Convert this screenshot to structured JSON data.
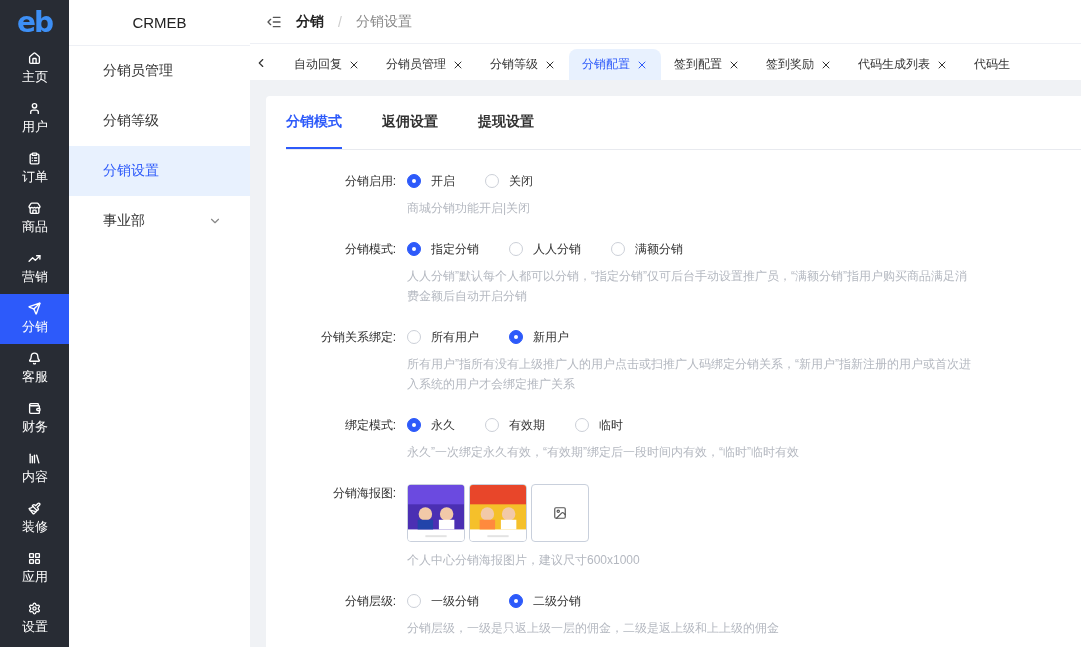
{
  "rail": {
    "logo": "eb",
    "items": [
      {
        "label": "主页",
        "selected": false
      },
      {
        "label": "用户",
        "selected": false
      },
      {
        "label": "订单",
        "selected": false
      },
      {
        "label": "商品",
        "selected": false
      },
      {
        "label": "营销",
        "selected": false
      },
      {
        "label": "分销",
        "selected": true
      },
      {
        "label": "客服",
        "selected": false
      },
      {
        "label": "财务",
        "selected": false
      },
      {
        "label": "内容",
        "selected": false
      },
      {
        "label": "装修",
        "selected": false
      },
      {
        "label": "应用",
        "selected": false
      },
      {
        "label": "设置",
        "selected": false
      }
    ]
  },
  "submenu": {
    "title": "CRMEB",
    "items": [
      {
        "label": "分销员管理",
        "selected": false
      },
      {
        "label": "分销等级",
        "selected": false
      },
      {
        "label": "分销设置",
        "selected": true
      },
      {
        "label": "事业部",
        "selected": false,
        "expanded": false
      }
    ]
  },
  "breadcrumb": {
    "separator": "/",
    "items": [
      "分销",
      "分销设置"
    ]
  },
  "page_tabs": [
    {
      "label": "自动回复",
      "selected": false,
      "closable": true
    },
    {
      "label": "分销员管理",
      "selected": false,
      "closable": true
    },
    {
      "label": "分销等级",
      "selected": false,
      "closable": true
    },
    {
      "label": "分销配置",
      "selected": true,
      "closable": true
    },
    {
      "label": "签到配置",
      "selected": false,
      "closable": true
    },
    {
      "label": "签到奖励",
      "selected": false,
      "closable": true
    },
    {
      "label": "代码生成列表",
      "selected": false,
      "closable": true
    },
    {
      "label": "代码生",
      "selected": false,
      "closable": false
    }
  ],
  "tabs": [
    {
      "label": "分销模式",
      "selected": true
    },
    {
      "label": "返佣设置",
      "selected": false
    },
    {
      "label": "提现设置",
      "selected": false
    }
  ],
  "form": [
    {
      "kind": "radio",
      "label": "分销启用:",
      "options": [
        {
          "label": "开启",
          "selected": true
        },
        {
          "label": "关闭",
          "selected": false
        }
      ],
      "help": "商城分销功能开启|关闭"
    },
    {
      "kind": "radio",
      "label": "分销模式:",
      "options": [
        {
          "label": "指定分销",
          "selected": true
        },
        {
          "label": "人人分销",
          "selected": false
        },
        {
          "label": "满额分销",
          "selected": false
        }
      ],
      "help": "人人分销”默认每个人都可以分销，“指定分销”仅可后台手动设置推广员，“满额分销”指用户购买商品满足消费金额后自动开启分销"
    },
    {
      "kind": "radio",
      "label": "分销关系绑定:",
      "options": [
        {
          "label": "所有用户",
          "selected": false
        },
        {
          "label": "新用户",
          "selected": true
        }
      ],
      "help": "所有用户”指所有没有上级推广人的用户点击或扫推广人码绑定分销关系，“新用户”指新注册的用户或首次进入系统的用户才会绑定推广关系"
    },
    {
      "kind": "radio",
      "label": "绑定模式:",
      "options": [
        {
          "label": "永久",
          "selected": true
        },
        {
          "label": "有效期",
          "selected": false
        },
        {
          "label": "临时",
          "selected": false
        }
      ],
      "help": "永久”一次绑定永久有效，“有效期”绑定后一段时间内有效，“临时”临时有效"
    },
    {
      "kind": "images",
      "label": "分销海报图:",
      "help": "个人中心分销海报图片，建议尺寸600x1000"
    },
    {
      "kind": "radio",
      "label": "分销层级:",
      "options": [
        {
          "label": "一级分销",
          "selected": false
        },
        {
          "label": "二级分销",
          "selected": true
        }
      ],
      "help": "分销层级，一级是只返上级一层的佣金，二级是返上级和上上级的佣金"
    }
  ]
}
